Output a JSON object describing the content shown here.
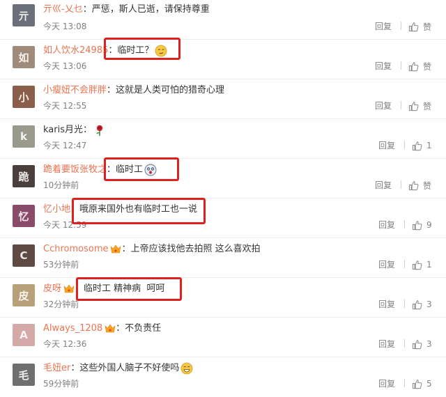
{
  "actions": {
    "reply_label": "回复"
  },
  "comments": [
    {
      "avatar_color": "#6b6f79",
      "user": "亓巛-乂乜",
      "text": "严惩，斯人已逝，请保持尊重",
      "emoji": "",
      "vip": false,
      "time": "今天 13:08",
      "like_label": "赞"
    },
    {
      "avatar_color": "#a08a7a",
      "user": "如人饮水24985",
      "text": "临时工？",
      "emoji": "smirk-emoji",
      "vip": false,
      "time": "今天 13:06",
      "like_label": "赞"
    },
    {
      "avatar_color": "#8b5e4c",
      "user": "小瘦妞不会胖胖",
      "text": "这就是人类可怕的猎奇心理",
      "emoji": "",
      "vip": false,
      "time": "今天 12:55",
      "like_label": "赞"
    },
    {
      "avatar_color": "#9a9a8c",
      "user": "karis月光",
      "text": "",
      "emoji": "rose-emoji",
      "vip": false,
      "time": "今天 12:47",
      "like_label": "1"
    },
    {
      "avatar_color": "#4a3f3c",
      "user": "跪着要饭张牧之",
      "text": "临时工",
      "emoji": "shocked-emoji",
      "vip": false,
      "time": "10分钟前",
      "like_label": "赞"
    },
    {
      "avatar_color": "#8a4a6a",
      "user": "忆小地",
      "text": "哦原来国外也有临时工也一说",
      "emoji": "",
      "vip": false,
      "time": "今天 12:59",
      "like_label": "9"
    },
    {
      "avatar_color": "#5e4a42",
      "user": "Cchromosome",
      "text": "上帝应该找他去拍照 这么喜欢拍",
      "emoji": "",
      "vip": true,
      "time": "53分钟前",
      "like_label": "1"
    },
    {
      "avatar_color": "#b8a079",
      "user": "皮呀",
      "text": "临时工 精神病  呵呵",
      "emoji": "",
      "vip": true,
      "time": "32分钟前",
      "like_label": "3"
    },
    {
      "avatar_color": "#d6a9a9",
      "user": "Always_1208",
      "text": "不负责任",
      "emoji": "",
      "vip": true,
      "time": "今天 12:36",
      "like_label": "3"
    },
    {
      "avatar_color": "#6f6f6f",
      "user": "毛妞er",
      "text": "这些外国人脑子不好使吗",
      "emoji": "grin-sweat-emoji",
      "vip": false,
      "time": "59分钟前",
      "like_label": "5"
    }
  ],
  "colors": {
    "username": "#eb7350",
    "highlight": "#e0201f",
    "meta": "#808080"
  }
}
